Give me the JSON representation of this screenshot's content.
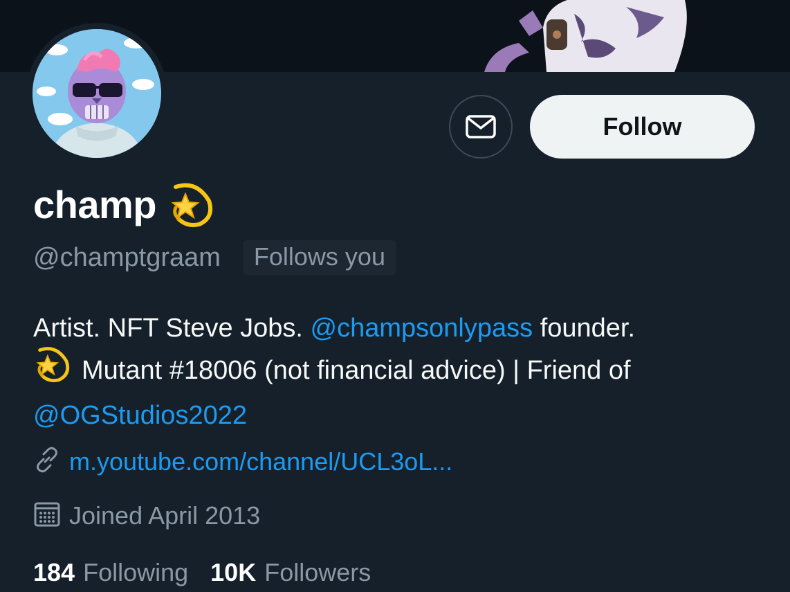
{
  "profile": {
    "display_name": "champ",
    "name_emoji": "dizzy-icon",
    "handle": "@champtgraam",
    "follows_you_badge": "Follows you"
  },
  "actions": {
    "message_icon": "envelope-icon",
    "follow_label": "Follow"
  },
  "bio": {
    "part1": "Artist. NFT Steve Jobs. ",
    "mention1": "@champsonlypass",
    "part2": " founder.",
    "part3": "Mutant #18006 (not financial advice) | Friend of",
    "mention2": "@OGStudios2022"
  },
  "meta": {
    "link_icon": "link-icon",
    "link_text": "m.youtube.com/channel/UCL3oL...",
    "calendar_icon": "calendar-icon",
    "joined_text": "Joined April 2013"
  },
  "stats": {
    "following_count": "184",
    "following_label": "Following",
    "followers_count": "10K",
    "followers_label": "Followers"
  },
  "colors": {
    "background": "#15202b",
    "accent": "#1d9bf0",
    "secondary_text": "#8b98a5",
    "follow_button_bg": "#eff3f4"
  }
}
